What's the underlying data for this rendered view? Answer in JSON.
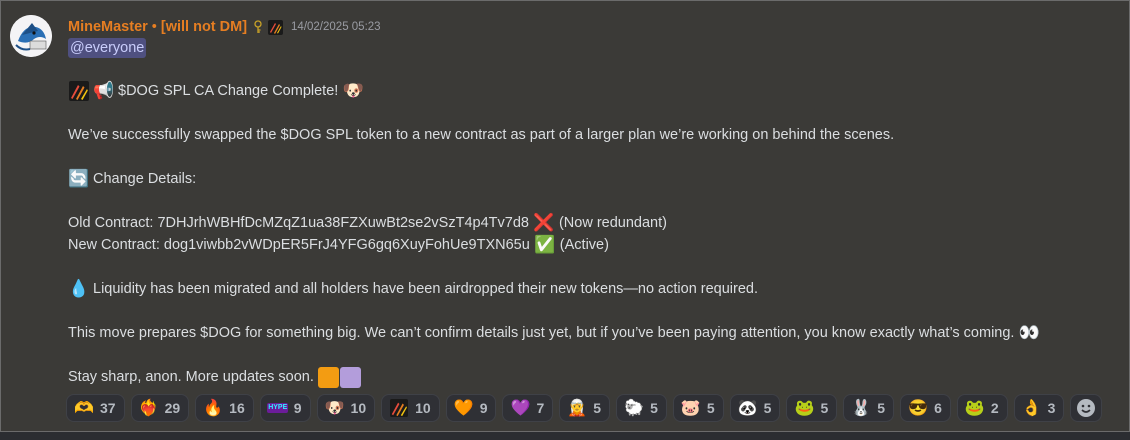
{
  "author": {
    "username": "MineMaster",
    "separator": "•",
    "tag": "[will not DM]",
    "timestamp": "14/02/2025 05:23"
  },
  "mention": "@everyone",
  "message": {
    "headline": "$DOG SPL CA Change Complete!",
    "intro": "We’ve successfully swapped the $DOG SPL token to a new contract as part of a larger plan we’re working on behind the scenes.",
    "change_details_label": "Change Details:",
    "old_contract_label": "Old Contract: 7DHJrhWBHfDcMZqZ1ua38FZXuwBt2se2vSzT4p4Tv7d8",
    "old_contract_status": "(Now redundant)",
    "new_contract_label": "New Contract: dog1viwbb2vWDpER5FrJ4YFG6gq6XuyFohUe9TXN65u",
    "new_contract_status": "(Active)",
    "liquidity": "Liquidity has been migrated and all holders have been airdropped their new tokens—no action required.",
    "prepares": "This move prepares $DOG for something big. We can’t confirm details just yet, but if you’ve been paying attention, you know exactly what’s coming.",
    "signoff": "Stay sharp, anon. More updates soon."
  },
  "emoji": {
    "megaphone": "📢",
    "dog_face": "🐶",
    "refresh": "🔄",
    "cross": "❌",
    "check": "✅",
    "droplet": "💧",
    "eyes": "👀"
  },
  "colors": {
    "username": "#e67e22",
    "mention_bg": "#4f5080",
    "swatch_orange": "#f39c12",
    "swatch_purple": "#b39ddb"
  },
  "reactions": [
    {
      "name": "pepe-hands-icon",
      "glyph": "🫶",
      "count": "37"
    },
    {
      "name": "fire-heart-icon",
      "glyph": "❤️‍🔥",
      "count": "29"
    },
    {
      "name": "fire-icon",
      "glyph": "🔥",
      "count": "16"
    },
    {
      "name": "hype-icon",
      "glyph": "HYPE",
      "count": "9"
    },
    {
      "name": "dog-face-icon",
      "glyph": "🐶",
      "count": "10"
    },
    {
      "name": "server-logo-icon",
      "glyph": "",
      "count": "10"
    },
    {
      "name": "orange-heart-icon",
      "glyph": "🧡",
      "count": "9"
    },
    {
      "name": "purple-heart-icon",
      "glyph": "💜",
      "count": "7"
    },
    {
      "name": "sticker-1-icon",
      "glyph": "🧝",
      "count": "5"
    },
    {
      "name": "sticker-2-icon",
      "glyph": "🐑",
      "count": "5"
    },
    {
      "name": "sticker-3-icon",
      "glyph": "🐷",
      "count": "5"
    },
    {
      "name": "sticker-4-icon",
      "glyph": "🐼",
      "count": "5"
    },
    {
      "name": "sticker-5-icon",
      "glyph": "🐸",
      "count": "5"
    },
    {
      "name": "sticker-6-icon",
      "glyph": "🐰",
      "count": "5"
    },
    {
      "name": "sunglasses-icon",
      "glyph": "😎",
      "count": "6"
    },
    {
      "name": "pepe-icon",
      "glyph": "🐸",
      "count": "2"
    },
    {
      "name": "ok-hand-icon",
      "glyph": "👌",
      "count": "3"
    }
  ]
}
